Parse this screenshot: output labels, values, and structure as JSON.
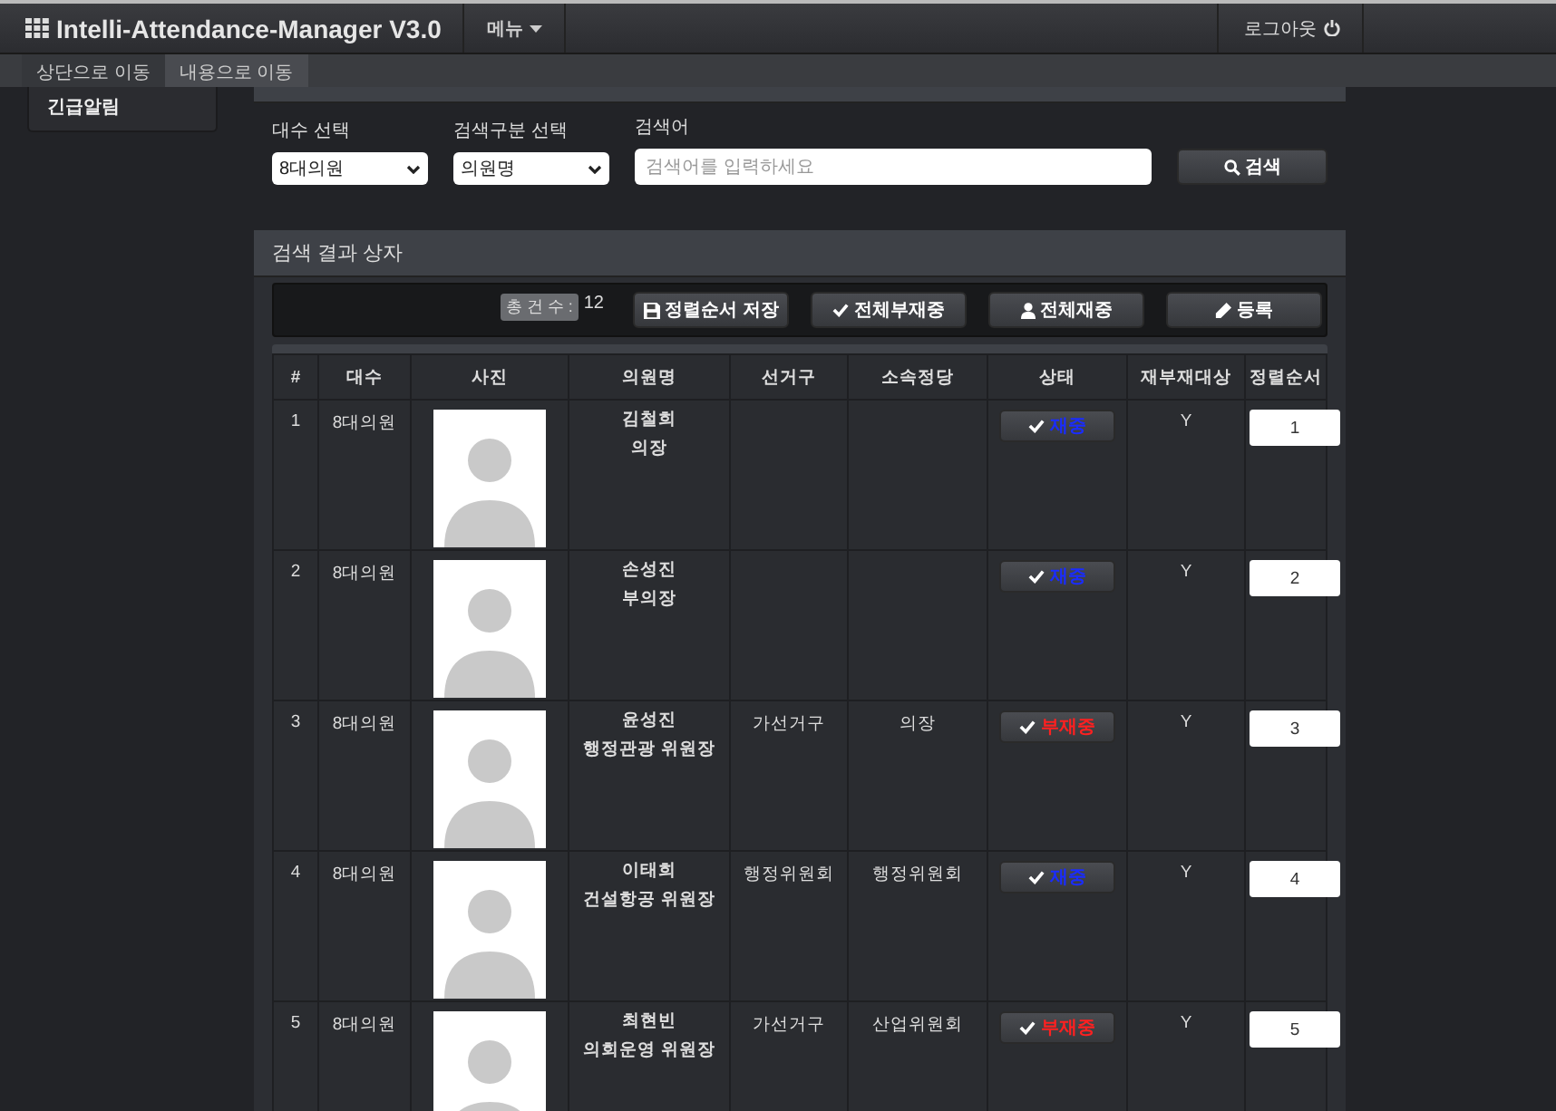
{
  "navbar": {
    "brand": "Intelli-Attendance-Manager V3.0",
    "menu": "메뉴",
    "logout": "로그아웃"
  },
  "skip_links": [
    {
      "label": "상단으로 이동",
      "selected": false
    },
    {
      "label": "내용으로 이동",
      "selected": true
    }
  ],
  "dropdown": {
    "items": [
      "긴급알림"
    ]
  },
  "search": {
    "fields": [
      {
        "label": "대수 선택",
        "kind": "select",
        "value": "8대의원"
      },
      {
        "label": "검색구분 선택",
        "kind": "select",
        "value": "의원명"
      },
      {
        "label": "검색어",
        "kind": "text",
        "placeholder": "검색어를 입력하세요"
      }
    ],
    "button": "검색"
  },
  "results": {
    "title": "검색 결과 상자",
    "total_label": "총 건 수 :",
    "total": "12",
    "buttons": [
      {
        "label": "정렬순서 저장",
        "kind": "save"
      },
      {
        "label": "전체부재중",
        "kind": "check"
      },
      {
        "label": "전체재중",
        "kind": "user"
      },
      {
        "label": "등록",
        "kind": "pencil"
      }
    ],
    "columns": [
      "#",
      "대수",
      "사진",
      "의원명",
      "선거구",
      "소속정당",
      "상태",
      "재부재대상",
      "정렬순서"
    ],
    "rows": [
      {
        "no": "1",
        "term": "8대의원",
        "name": "김철희",
        "role": "의장",
        "district": "",
        "party": "",
        "status": "재중",
        "present": true,
        "target": "Y",
        "order": "1"
      },
      {
        "no": "2",
        "term": "8대의원",
        "name": "손성진",
        "role": "부의장",
        "district": "",
        "party": "",
        "status": "재중",
        "present": true,
        "target": "Y",
        "order": "2"
      },
      {
        "no": "3",
        "term": "8대의원",
        "name": "윤성진",
        "role": "행정관광 위원장",
        "district": "가선거구",
        "party": "의장",
        "status": "부재중",
        "present": false,
        "target": "Y",
        "order": "3"
      },
      {
        "no": "4",
        "term": "8대의원",
        "name": "이태희",
        "role": "건설항공 위원장",
        "district": "행정위원회",
        "party": "행정위원회",
        "status": "재중",
        "present": true,
        "target": "Y",
        "order": "4"
      },
      {
        "no": "5",
        "term": "8대의원",
        "name": "최현빈",
        "role": "의회운영 위원장",
        "district": "가선거구",
        "party": "산업위원회",
        "status": "부재중",
        "present": false,
        "target": "Y",
        "order": "5"
      }
    ]
  }
}
